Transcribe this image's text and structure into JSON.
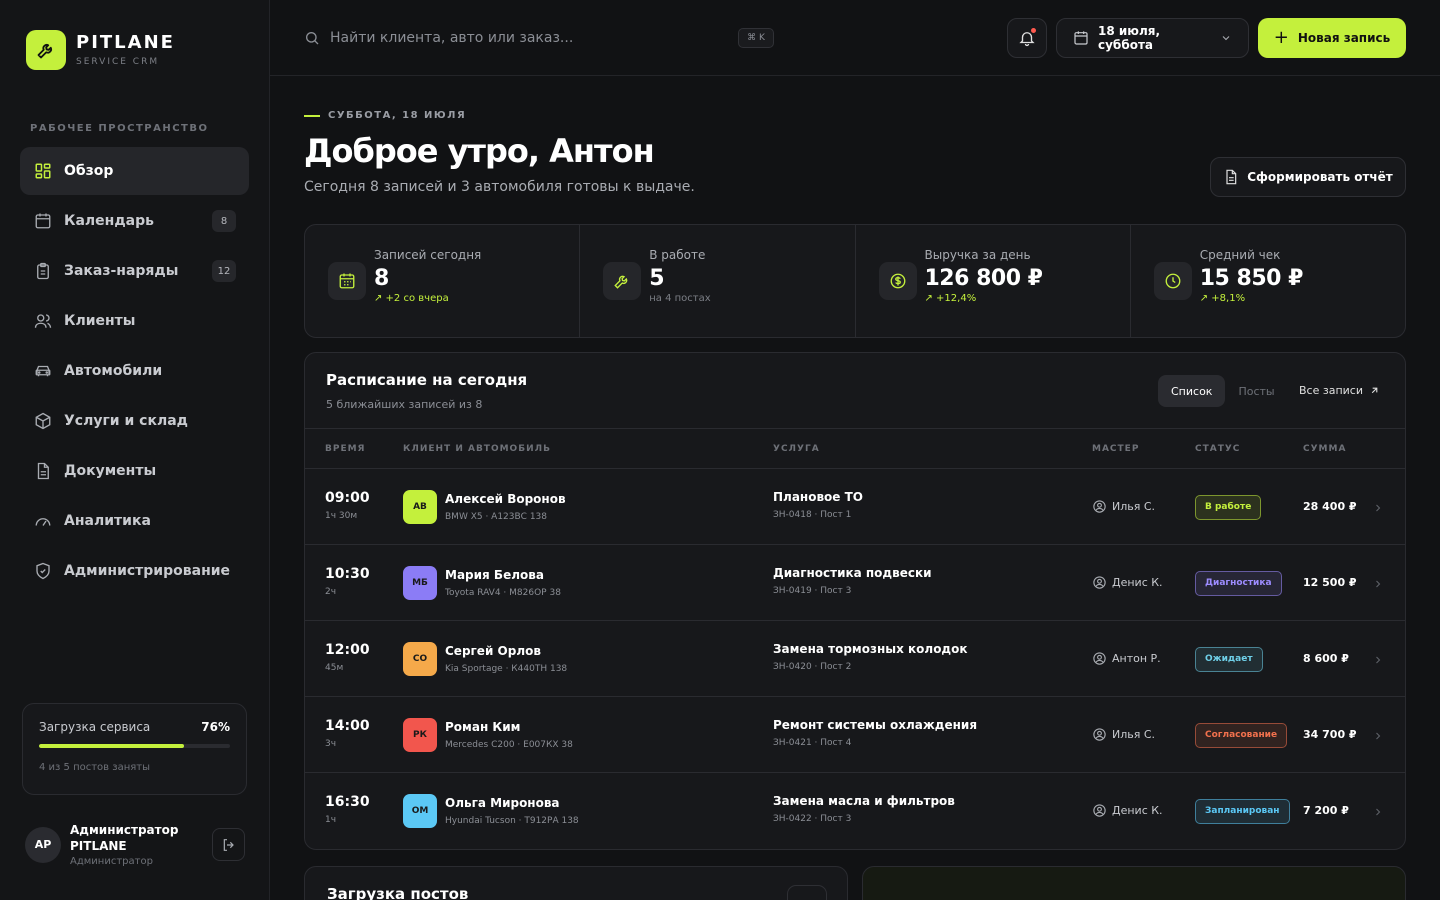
{
  "app": {
    "name": "PITLANE",
    "subtitle": "SERVICE CRM"
  },
  "colors": {
    "accent": "#c4f03c",
    "background": "#111214",
    "panel": "#17181b"
  },
  "sidebar": {
    "section_label": "РАБОЧЕЕ ПРОСТРАНСТВО",
    "items": [
      {
        "label": "Обзор",
        "icon": "grid-icon",
        "active": true,
        "badge": ""
      },
      {
        "label": "Календарь",
        "icon": "calendar-icon",
        "active": false,
        "badge": "8"
      },
      {
        "label": "Заказ-наряды",
        "icon": "clipboard-icon",
        "active": false,
        "badge": "12"
      },
      {
        "label": "Клиенты",
        "icon": "users-icon",
        "active": false,
        "badge": ""
      },
      {
        "label": "Автомобили",
        "icon": "car-icon",
        "active": false,
        "badge": ""
      },
      {
        "label": "Услуги и склад",
        "icon": "box-icon",
        "active": false,
        "badge": ""
      },
      {
        "label": "Документы",
        "icon": "document-icon",
        "active": false,
        "badge": ""
      },
      {
        "label": "Аналитика",
        "icon": "gauge-icon",
        "active": false,
        "badge": ""
      },
      {
        "label": "Администрирование",
        "icon": "shield-icon",
        "active": false,
        "badge": ""
      }
    ],
    "load": {
      "title": "Загрузка сервиса",
      "percent_label": "76%",
      "percent": 76,
      "note": "4 из 5 постов заняты"
    },
    "user": {
      "initials": "АР",
      "name": "Администратор PITLANE",
      "role": "Администратор"
    }
  },
  "topbar": {
    "search_placeholder": "Найти клиента, авто или заказ...",
    "shortcut": "⌘ K",
    "date": "18 июля, суббота",
    "new_button": "Новая запись"
  },
  "header": {
    "eyebrow": "СУББОТА, 18 ИЮЛЯ",
    "greeting": "Доброе утро, Антон",
    "subtitle": "Сегодня 8 записей и 3 автомобиля готовы к выдаче.",
    "report_button": "Сформировать отчёт"
  },
  "stats": [
    {
      "label": "Записей сегодня",
      "value": "8",
      "note": "↗ +2 со вчера",
      "trend": "up",
      "icon": "calendar-icon"
    },
    {
      "label": "В работе",
      "value": "5",
      "note": "на 4 постах",
      "trend": "neutral",
      "icon": "wrench-icon"
    },
    {
      "label": "Выручка за день",
      "value": "126 800 ₽",
      "note": "↗ +12,4%",
      "trend": "up",
      "icon": "dollar-icon"
    },
    {
      "label": "Средний чек",
      "value": "15 850 ₽",
      "note": "↗ +8,1%",
      "trend": "up",
      "icon": "clock-icon"
    }
  ],
  "schedule": {
    "title": "Расписание на сегодня",
    "subtitle": "5 ближайших записей из 8",
    "view_list": "Список",
    "view_posts": "Посты",
    "all_link": "Все записи",
    "columns": {
      "time": "ВРЕМЯ",
      "client": "КЛИЕНТ И АВТОМОБИЛЬ",
      "service": "УСЛУГА",
      "master": "МАСТЕР",
      "status": "СТАТУС",
      "sum": "СУММА"
    },
    "rows": [
      {
        "time": "09:00",
        "duration": "1ч 30м",
        "initials": "АВ",
        "avatar_color": "#c4f03c",
        "client": "Алексей Воронов",
        "car": "BMW X5 · А123ВС 138",
        "service": "Плановое ТО",
        "meta": "ЗН-0418 · Пост 1",
        "master": "Илья С.",
        "status": "В работе",
        "status_color": "#c4f03c",
        "sum": "28 400 ₽"
      },
      {
        "time": "10:30",
        "duration": "2ч",
        "initials": "МБ",
        "avatar_color": "#8b7cf6",
        "client": "Мария Белова",
        "car": "Toyota RAV4 · М826ОР 38",
        "service": "Диагностика подвески",
        "meta": "ЗН-0419 · Пост 3",
        "master": "Денис К.",
        "status": "Диагностика",
        "status_color": "#9d8cff",
        "sum": "12 500 ₽"
      },
      {
        "time": "12:00",
        "duration": "45м",
        "initials": "СО",
        "avatar_color": "#f5a94a",
        "client": "Сергей Орлов",
        "car": "Kia Sportage · К440ТН 138",
        "service": "Замена тормозных колодок",
        "meta": "ЗН-0420 · Пост 2",
        "master": "Антон Р.",
        "status": "Ожидает",
        "status_color": "#6fd0e8",
        "sum": "8 600 ₽"
      },
      {
        "time": "14:00",
        "duration": "3ч",
        "initials": "РК",
        "avatar_color": "#f2564d",
        "client": "Роман Ким",
        "car": "Mercedes C200 · Е007КХ 38",
        "service": "Ремонт системы охлаждения",
        "meta": "ЗН-0421 · Пост 4",
        "master": "Илья С.",
        "status": "Согласование",
        "status_color": "#f2714d",
        "sum": "34 700 ₽"
      },
      {
        "time": "16:30",
        "duration": "1ч",
        "initials": "ОМ",
        "avatar_color": "#5bc8f5",
        "client": "Ольга Миронова",
        "car": "Hyundai Tucson · Т912РА 138",
        "service": "Замена масла и фильтров",
        "meta": "ЗН-0422 · Пост 3",
        "master": "Денис К.",
        "status": "Запланирован",
        "status_color": "#5bc8f5",
        "sum": "7 200 ₽"
      }
    ]
  },
  "bottom": {
    "posts_title": "Загрузка постов"
  }
}
